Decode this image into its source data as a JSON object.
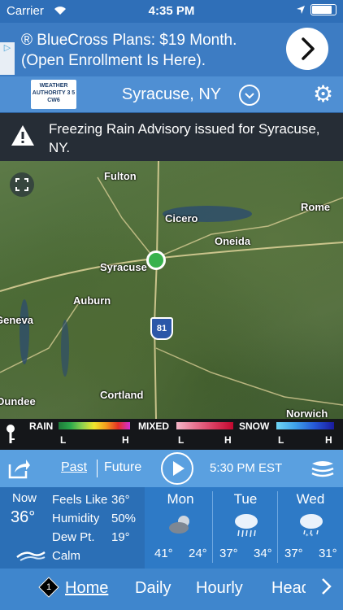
{
  "status_bar": {
    "carrier": "Carrier",
    "time": "4:35 PM"
  },
  "ad": {
    "text": "® BlueCross Plans: $19 Month. (Open Enrollment Is Here).",
    "adchoices_label": "▷"
  },
  "header": {
    "logo_text": "WEATHER AUTHORITY 3 5 CW6",
    "location": "Syracuse, NY"
  },
  "advisory": {
    "message": "Freezing Rain Advisory issued for Syracuse, NY."
  },
  "map": {
    "places": [
      "Fulton",
      "Cicero",
      "Rome",
      "Oneida",
      "Syracuse",
      "Auburn",
      "Geneva",
      "Cortland",
      "Norwich",
      "Dundee"
    ],
    "highway_shield": "81"
  },
  "legend": {
    "rain_label": "RAIN",
    "mixed_label": "MIXED",
    "snow_label": "SNOW",
    "low": "L",
    "high": "H"
  },
  "controls": {
    "past": "Past",
    "future": "Future",
    "timestamp": "5:30 PM EST"
  },
  "current": {
    "now_label": "Now",
    "temp": "36°",
    "feels_like_label": "Feels Like",
    "feels_like": "36°",
    "humidity_label": "Humidity",
    "humidity": "50%",
    "dew_point_label": "Dew Pt.",
    "dew_point": "19°",
    "wind": "Calm"
  },
  "forecast": [
    {
      "day": "Mon",
      "hi": "41°",
      "lo": "24°",
      "icon": "cloudy-icon"
    },
    {
      "day": "Tue",
      "hi": "37°",
      "lo": "34°",
      "icon": "rain-icon"
    },
    {
      "day": "Wed",
      "hi": "37°",
      "lo": "31°",
      "icon": "snow-rain-icon"
    }
  ],
  "nav": {
    "badge": "1",
    "home": "Home",
    "daily": "Daily",
    "hourly": "Hourly",
    "headlines": "Headlines"
  }
}
